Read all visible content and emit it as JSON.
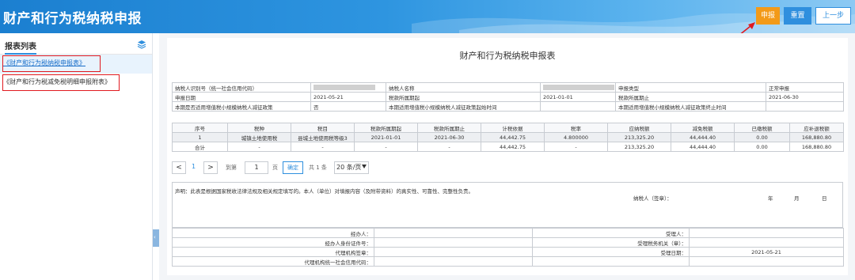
{
  "app": {
    "title": "财产和行为税纳税申报"
  },
  "toolbar": {
    "submit_label": "申报",
    "reset_label": "重置",
    "prev_label": "上一步"
  },
  "sidebar": {
    "title": "报表列表",
    "icon": "stack-icon",
    "items": [
      {
        "label": "《财产和行为税纳税申报表》",
        "active": true
      },
      {
        "label": "《财产和行为税减免税明细申报附表》",
        "active": false
      }
    ]
  },
  "form": {
    "title": "财产和行为税纳税申报表",
    "info": {
      "taxpayer_id_label": "纳税人识别号（统一社会信用代码）",
      "taxpayer_name_label": "纳税人名称",
      "declare_type_label": "申报类型",
      "declare_type_value": "正常申报",
      "declare_date_label": "申报日期",
      "declare_date_value": "2021-05-21",
      "period_start_label": "税款所属期起",
      "period_start_value": "2021-01-01",
      "period_end_label": "税款所属期止",
      "period_end_value": "2021-06-30",
      "policy_label": "本期是否适用增值税小规模纳税人减征政策",
      "policy_value": "否",
      "policy_start_label": "本期适用增值税小规模纳税人减征政策起始时间",
      "policy_end_label": "本期适用增值税小规模纳税人减征政策终止时间"
    },
    "columns": [
      "序号",
      "税种",
      "税目",
      "税款所属期起",
      "税款所属期止",
      "计税依据",
      "税率",
      "应纳税额",
      "减免税额",
      "已缴税额",
      "应补退税额"
    ],
    "rows": [
      [
        "1",
        "城镇土地使用税",
        "县城土地使用税等级3",
        "2021-01-01",
        "2021-06-30",
        "44,442.75",
        "4.800000",
        "213,325.20",
        "44,444.40",
        "0.00",
        "168,880.80"
      ],
      [
        "合计",
        "-",
        "-",
        "-",
        "-",
        "44,442.75",
        "-",
        "213,325.20",
        "44,444.40",
        "0.00",
        "168,880.80"
      ]
    ]
  },
  "pager": {
    "prev": "<",
    "page": "1",
    "next": ">",
    "goto_label": "到第",
    "goto_value": "1",
    "page_unit": "页",
    "confirm_label": "确定",
    "total": "共 1 条",
    "page_size": "20 条/页"
  },
  "declaration": {
    "text": "声明：此表是根据国家税收法律法规及相关规定填写的。本人（单位）对填报内容（及附带资料）的真实性、可靠性、完整性负责。",
    "signer": "纳税人（签章）：",
    "year": "年",
    "month": "月",
    "day": "日"
  },
  "sign": {
    "handler": "经办人：",
    "handler_id": "经办人身份证件号：",
    "agency_seal": "代理机构签章：",
    "agency_code": "代理机构统一社会信用代码：",
    "receiver": "受理人：",
    "tax_office": "受理税务机关（章）：",
    "accept_date": "受理日期：",
    "accept_date_value": "2021-05-21"
  },
  "colors": {
    "accent": "#2f8fde",
    "submit": "#f39a18",
    "annotation": "#e0191f"
  }
}
